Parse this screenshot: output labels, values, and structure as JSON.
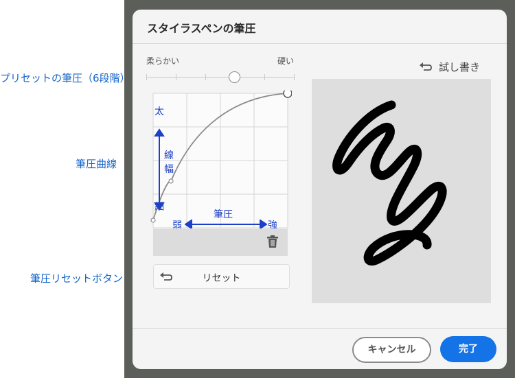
{
  "annotations": {
    "preset": "プリセットの筆圧（6段階）",
    "curve": "筆圧曲線",
    "reset": "筆圧リセットボタン"
  },
  "dialog": {
    "title": "スタイラスペンの筆圧",
    "slider": {
      "soft_label": "柔らかい",
      "hard_label": "硬い",
      "steps": 6,
      "selected_step": 4
    },
    "curve_area": {
      "y_top_label": "太",
      "y_middle_label": "線幅",
      "y_bottom_label": "細",
      "x_center_label": "筆圧",
      "x_left_label": "弱",
      "x_right_label": "強"
    },
    "reset_button": {
      "label": "リセット",
      "icon": "undo-icon"
    },
    "delete_icon": "trash-icon",
    "trial_button": {
      "label": "試し書き",
      "icon": "undo-icon"
    },
    "footer": {
      "cancel_label": "キャンセル",
      "done_label": "完了"
    }
  },
  "colors": {
    "annotation": "#1565c8",
    "accent": "#1473e6",
    "diagram_blue": "#1e40c8"
  }
}
